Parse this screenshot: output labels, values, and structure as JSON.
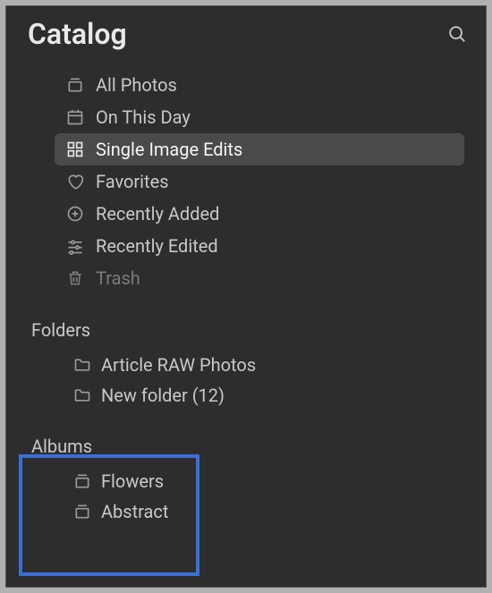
{
  "header": {
    "title": "Catalog",
    "search_icon": "search"
  },
  "catalog": {
    "items": [
      {
        "icon": "stack",
        "label": "All Photos",
        "selected": false,
        "dim": false
      },
      {
        "icon": "calendar",
        "label": "On This Day",
        "selected": false,
        "dim": false
      },
      {
        "icon": "grid",
        "label": "Single Image Edits",
        "selected": true,
        "dim": false
      },
      {
        "icon": "heart",
        "label": "Favorites",
        "selected": false,
        "dim": false
      },
      {
        "icon": "plus-circle",
        "label": "Recently Added",
        "selected": false,
        "dim": false
      },
      {
        "icon": "sliders",
        "label": "Recently Edited",
        "selected": false,
        "dim": false
      },
      {
        "icon": "trash",
        "label": "Trash",
        "selected": false,
        "dim": true
      }
    ]
  },
  "folders": {
    "label": "Folders",
    "items": [
      {
        "icon": "folder",
        "label": "Article RAW Photos"
      },
      {
        "icon": "folder",
        "label": "New folder (12)"
      }
    ]
  },
  "albums": {
    "label": "Albums",
    "items": [
      {
        "icon": "stack",
        "label": "Flowers"
      },
      {
        "icon": "stack",
        "label": "Abstract"
      }
    ]
  }
}
